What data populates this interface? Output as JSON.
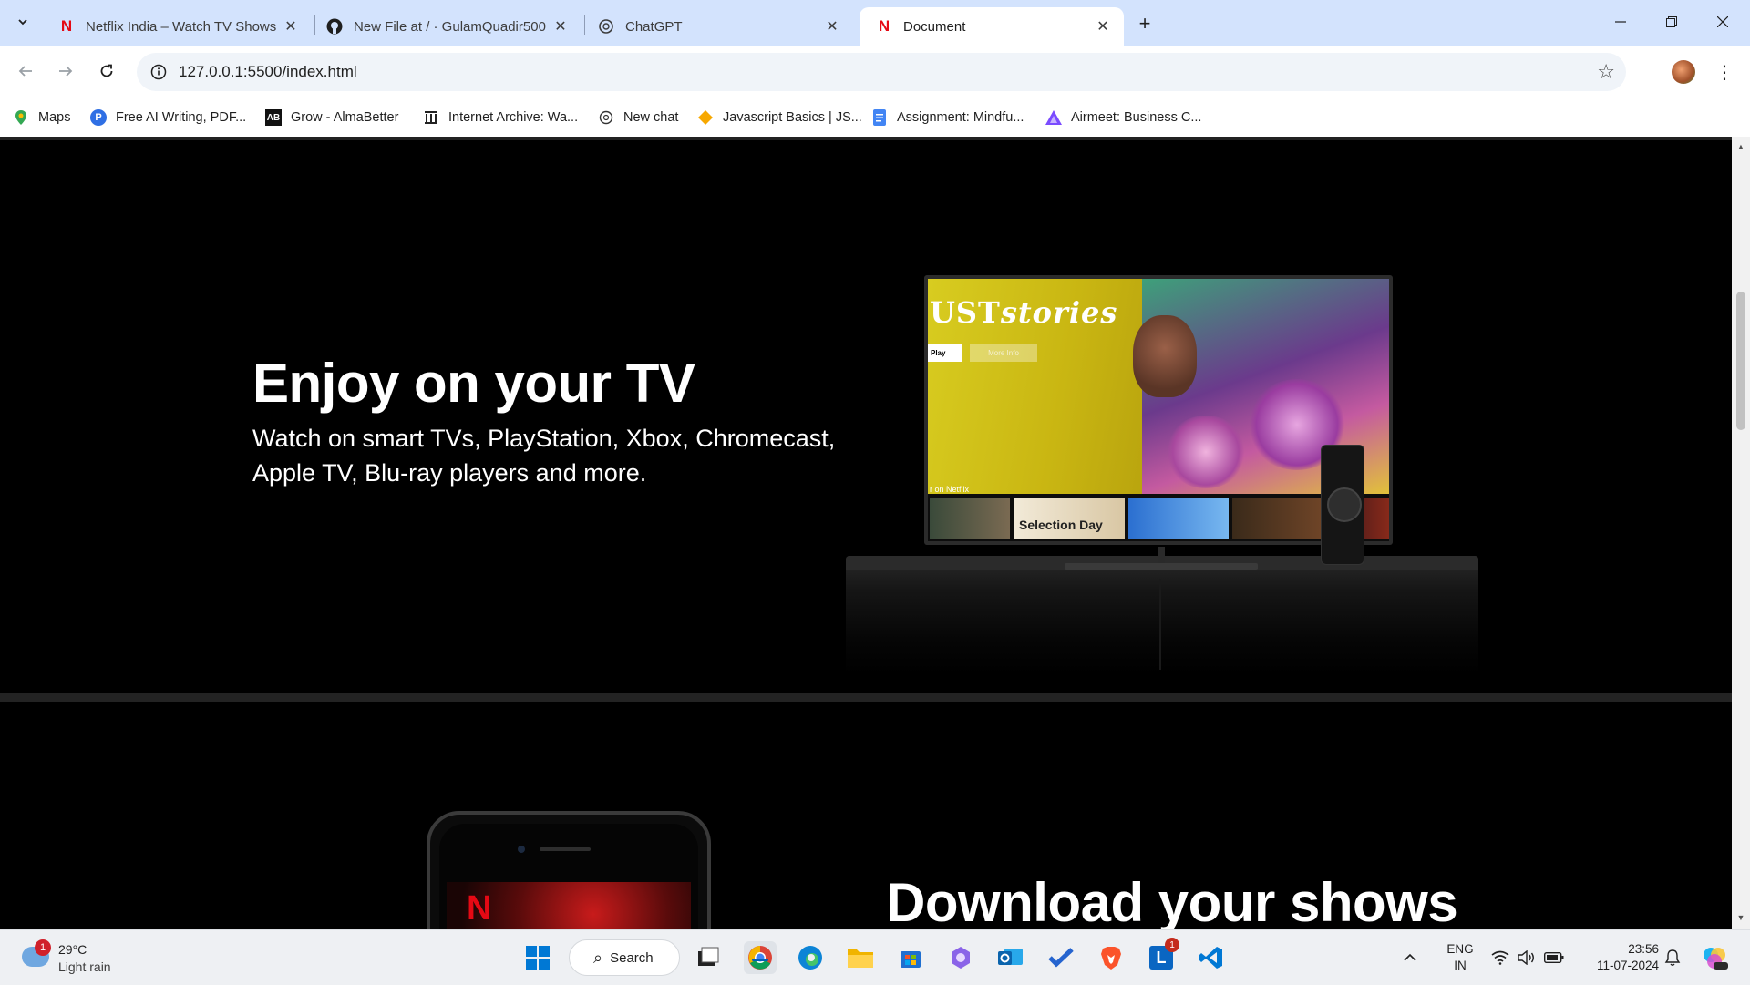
{
  "browser": {
    "tabs": [
      {
        "title": "Netflix India – Watch TV Shows",
        "icon": "netflix-icon",
        "active": false
      },
      {
        "title": "New File at / · GulamQuadir500",
        "icon": "github-icon",
        "active": false
      },
      {
        "title": "ChatGPT",
        "icon": "chatgpt-icon",
        "active": false
      },
      {
        "title": "Document",
        "icon": "netflix-icon",
        "active": true
      }
    ],
    "new_tab_label": "+",
    "url": "127.0.0.1:5500/index.html",
    "bookmarks": [
      {
        "label": "Maps",
        "icon": "maps-icon"
      },
      {
        "label": "Free AI Writing, PDF...",
        "icon": "ai-writing-icon"
      },
      {
        "label": "Grow - AlmaBetter",
        "icon": "almabetter-icon"
      },
      {
        "label": "Internet Archive: Wa...",
        "icon": "archive-icon"
      },
      {
        "label": "New chat",
        "icon": "chatgpt-icon"
      },
      {
        "label": "Javascript Basics | JS...",
        "icon": "diamond-icon"
      },
      {
        "label": "Assignment: Mindfu...",
        "icon": "docs-icon"
      },
      {
        "label": "Airmeet: Business C...",
        "icon": "airmeet-icon"
      }
    ]
  },
  "page": {
    "tv_section": {
      "title": "Enjoy on your TV",
      "subtitle": "Watch on smart TVs, PlayStation, Xbox, Chromecast, Apple TV, Blu-ray players and more."
    },
    "tv_screen": {
      "show_title_plain": "UST",
      "show_title_italic": "stories",
      "play_label": "Play",
      "more_info_label": "More Info",
      "row_label": "r on Netflix",
      "thumb_text": "Selection Day"
    },
    "download_section": {
      "title": "Download your shows"
    },
    "colors": {
      "netflix_red": "#e50914",
      "background": "#000000",
      "divider": "#232323"
    }
  },
  "taskbar": {
    "weather": {
      "temp": "29°C",
      "condition": "Light rain",
      "alert_count": "1"
    },
    "search_label": "Search",
    "apps": [
      "task-view-icon",
      "chrome-icon",
      "edge-icon",
      "file-explorer-icon",
      "store-icon",
      "copilot-icon",
      "outlook-icon",
      "todo-icon",
      "brave-icon",
      "linkedin-icon",
      "vscode-icon"
    ],
    "linkedin_badge": "1",
    "language": {
      "line1": "ENG",
      "line2": "IN"
    },
    "clock": {
      "time": "23:56",
      "date": "11-07-2024"
    }
  }
}
